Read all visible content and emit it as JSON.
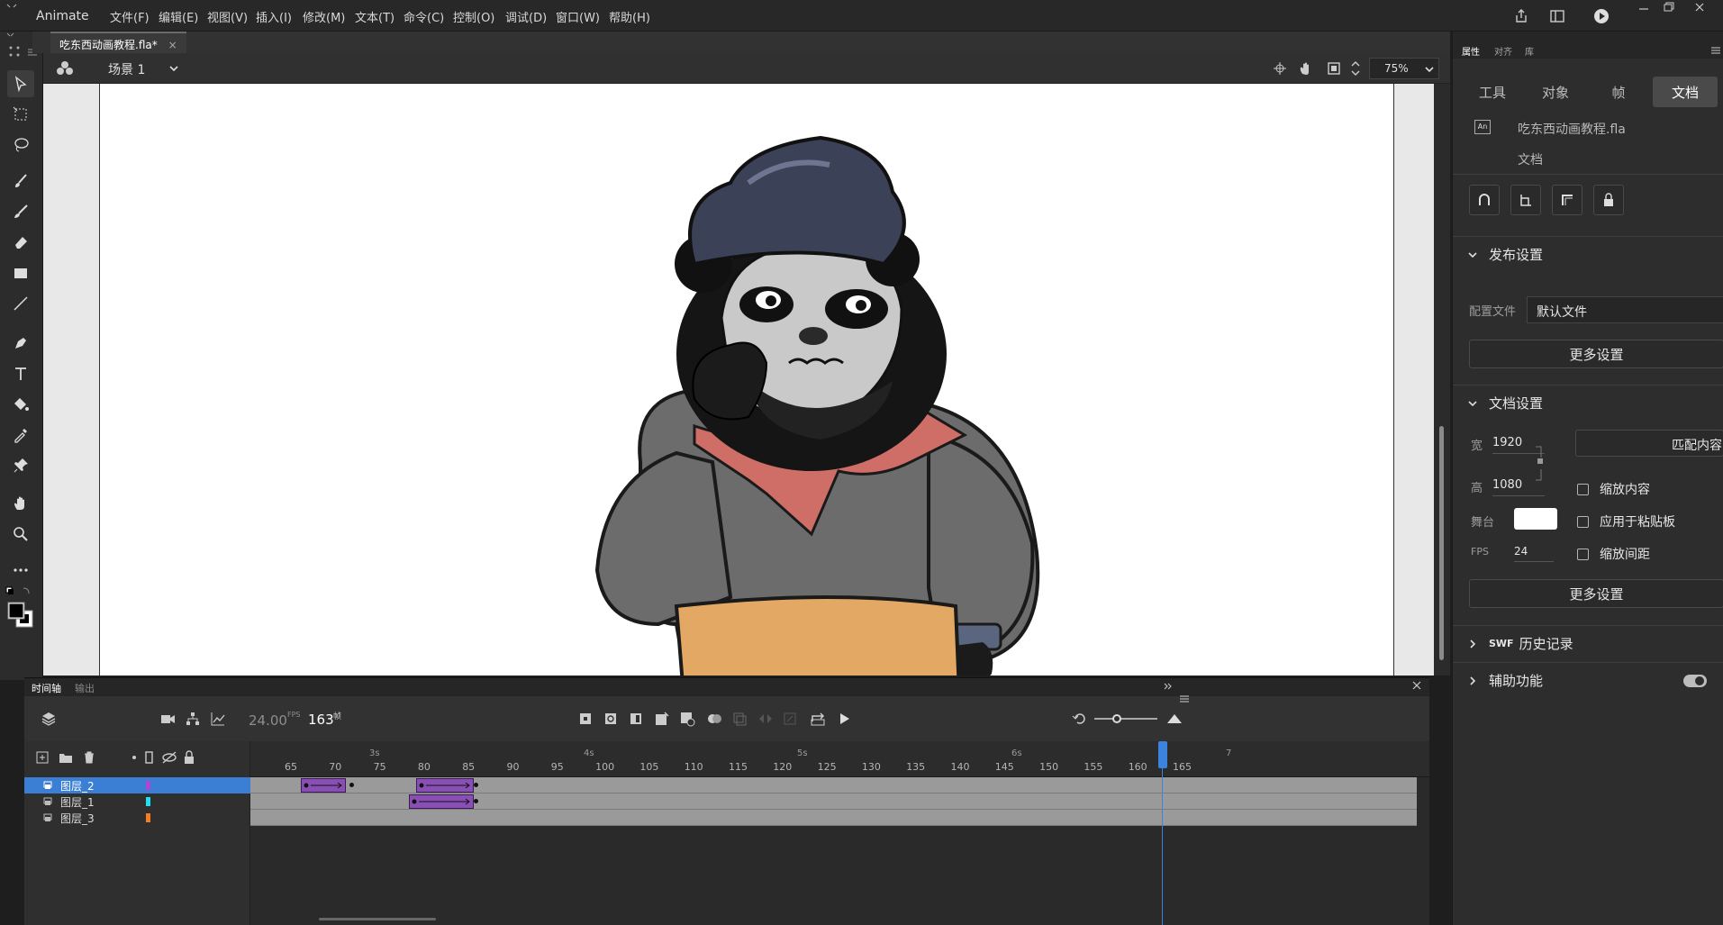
{
  "app": {
    "name": "Animate"
  },
  "menu": [
    "文件(F)",
    "编辑(E)",
    "视图(V)",
    "插入(I)",
    "修改(M)",
    "文本(T)",
    "命令(C)",
    "控制(O)",
    "调试(D)",
    "窗口(W)",
    "帮助(H)"
  ],
  "document": {
    "tab_label": "吃东西动画教程.fla*",
    "close_glyph": "×"
  },
  "scene": {
    "label": "场景 1",
    "zoom": "75%"
  },
  "tools": [
    "selection-tool",
    "free-transform-tool",
    "lasso-tool",
    "brush-tool",
    "paint-brush-tool",
    "eraser-tool",
    "rectangle-tool",
    "line-tool",
    "pen-tool",
    "text-tool",
    "paint-bucket-tool",
    "eyedropper-tool",
    "pin-tool",
    "hand-tool",
    "zoom-tool",
    "more-tools"
  ],
  "colors": {
    "accent": "#4a90e2",
    "tween": "#8a4fb5",
    "stroke_color": "#000000",
    "fill_color": "#ffffff",
    "layer_colors": [
      "#b044d8",
      "#1de0f0",
      "#f57d1f"
    ]
  },
  "timeline": {
    "tabs": [
      "时间轴",
      "输出"
    ],
    "fps": "24.00",
    "fps_unit": "FPS",
    "current_frame": "163",
    "frame_unit": "帧",
    "layers": [
      {
        "name": "图层_2",
        "selected": true
      },
      {
        "name": "图层_1",
        "selected": false
      },
      {
        "name": "图层_3",
        "selected": false
      }
    ],
    "frame_numbers": [
      "65",
      "70",
      "75",
      "80",
      "85",
      "90",
      "95",
      "100",
      "105",
      "110",
      "115",
      "120",
      "125",
      "130",
      "135",
      "140",
      "145",
      "150",
      "155",
      "160",
      "165"
    ],
    "seconds": [
      "3s",
      "4s",
      "5s",
      "6s",
      "7"
    ]
  },
  "properties": {
    "tabs": [
      "属性",
      "对齐",
      "库"
    ],
    "subtabs": [
      "工具",
      "对象",
      "帧",
      "文档"
    ],
    "file_name": "吃东西动画教程.fla",
    "file_type": "文档",
    "file_icon": "An",
    "publish_section": "发布设置",
    "profile_label": "配置文件",
    "profile_value": "默认文件",
    "more_settings": "更多设置",
    "doc_section": "文档设置",
    "width_label": "宽",
    "width_value": "1920",
    "height_label": "高",
    "height_value": "1080",
    "match_contents": "匹配内容",
    "scale_content": "缩放内容",
    "apply_pasteboard": "应用于粘贴板",
    "scale_spacing": "缩放间距",
    "stage_label": "舞台",
    "fps_label": "FPS",
    "fps_value": "24",
    "more_settings2": "更多设置",
    "swf_prefix": "SWF",
    "swf_history": "历史记录",
    "accessibility": "辅助功能"
  }
}
